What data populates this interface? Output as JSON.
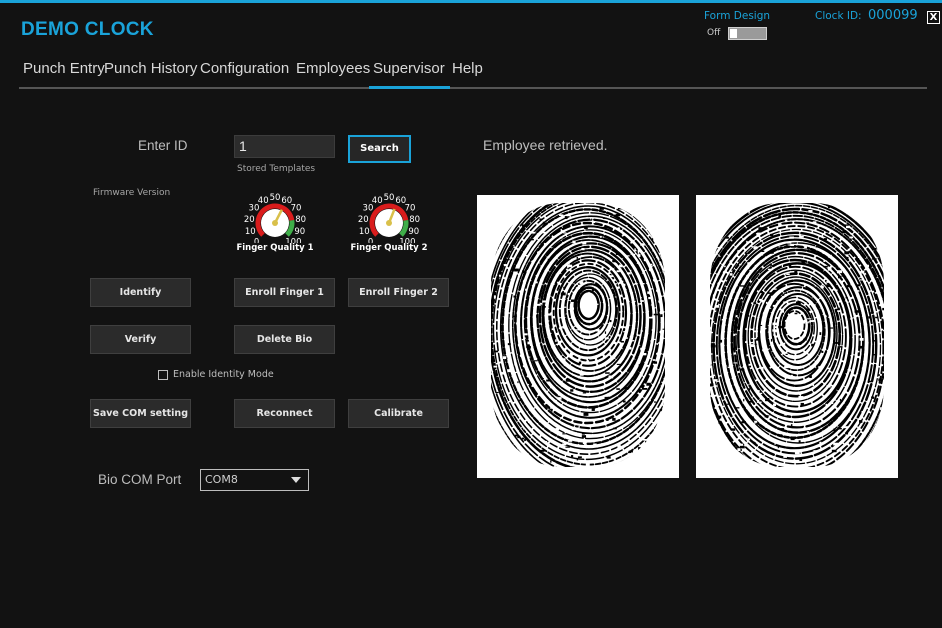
{
  "app": {
    "title": "DEMO CLOCK",
    "accent": "#1aa3d9"
  },
  "header": {
    "form_design_label": "Form Design",
    "form_design_state": "Off",
    "clock_id_label": "Clock ID:",
    "clock_id_value": "000099",
    "close_glyph": "X"
  },
  "nav": {
    "tabs": [
      {
        "label": "Punch Entry"
      },
      {
        "label": "Punch History"
      },
      {
        "label": "Configuration"
      },
      {
        "label": "Employees"
      },
      {
        "label": "Supervisor",
        "active": true
      },
      {
        "label": "Help"
      }
    ]
  },
  "form": {
    "enter_id_label": "Enter ID",
    "id_value": "1",
    "search_label": "Search",
    "stored_templates_label": "Stored Templates",
    "firmware_label": "Firmware Version",
    "status_message": "Employee retrieved.",
    "gauge1": {
      "title": "Finger Quality 1",
      "ticks": [
        "0",
        "10",
        "20",
        "30",
        "40",
        "50",
        "60",
        "70",
        "80",
        "90",
        "100"
      ],
      "value": 60
    },
    "gauge2": {
      "title": "Finger Quality 2",
      "ticks": [
        "0",
        "10",
        "20",
        "30",
        "40",
        "50",
        "60",
        "70",
        "80",
        "90",
        "100"
      ],
      "value": 58
    },
    "buttons": {
      "identify": "Identify",
      "enroll1": "Enroll Finger 1",
      "enroll2": "Enroll Finger 2",
      "verify": "Verify",
      "delete_bio": "Delete Bio",
      "save_com": "Save COM setting",
      "reconnect": "Reconnect",
      "calibrate": "Calibrate"
    },
    "identity_mode_label": "Enable Identity Mode",
    "identity_mode_checked": false,
    "com_port_label": "Bio COM Port",
    "com_port_value": "COM8"
  }
}
